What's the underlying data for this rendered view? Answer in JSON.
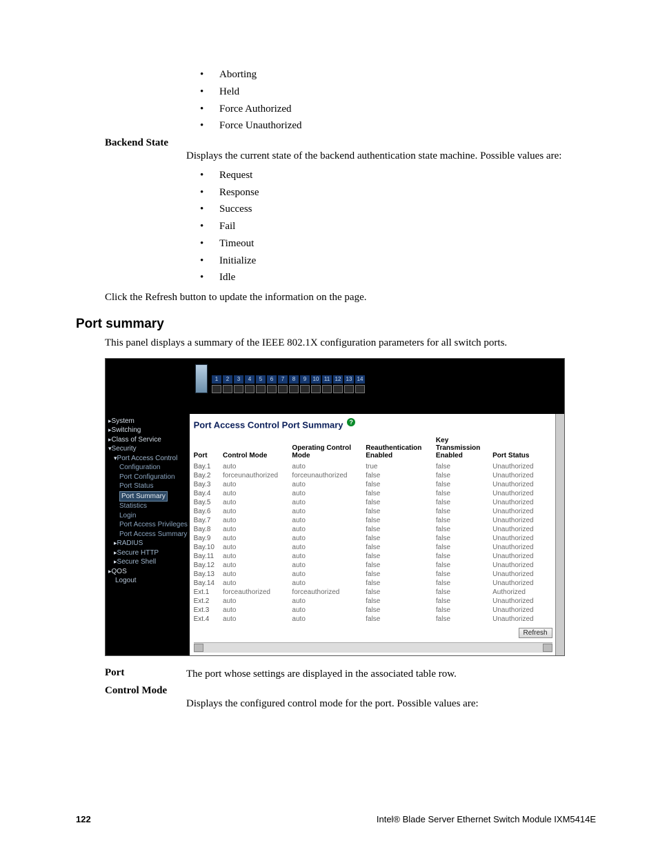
{
  "top_bullets": [
    "Aborting",
    "Held",
    "Force Authorized",
    "Force Unauthorized"
  ],
  "backend_state": {
    "term": "Backend State",
    "body": "Displays the current state of the backend authentication state machine. Possible values are:",
    "items": [
      "Request",
      "Response",
      "Success",
      "Fail",
      "Timeout",
      "Initialize",
      "Idle"
    ]
  },
  "refresh_para": "Click the Refresh button to update the information on the page.",
  "section_heading": "Port summary",
  "section_intro": "This panel displays a summary of the IEEE 802.1X configuration parameters for all switch ports.",
  "screenshot": {
    "port_numbers": [
      "1",
      "2",
      "3",
      "4",
      "5",
      "6",
      "7",
      "8",
      "9",
      "10",
      "11",
      "12",
      "13",
      "14"
    ],
    "nav": {
      "system": "System",
      "switching": "Switching",
      "class_of_service": "Class of Service",
      "security": "Security",
      "port_access_control": "Port Access Control",
      "configuration": "Configuration",
      "port_configuration": "Port Configuration",
      "port_status": "Port Status",
      "port_summary": "Port Summary",
      "statistics": "Statistics",
      "login": "Login",
      "port_access_privileges": "Port Access Privileges",
      "port_access_summary": "Port Access Summary",
      "radius": "RADIUS",
      "secure_http": "Secure HTTP",
      "secure_shell": "Secure Shell",
      "qos": "QOS",
      "logout": "Logout"
    },
    "panel_title": "Port Access Control Port Summary",
    "help_glyph": "?",
    "headers": {
      "port": "Port",
      "control_mode": "Control Mode",
      "operating_control_mode": "Operating Control\nMode",
      "reauth_enabled": "Reauthentication\nEnabled",
      "key_trans_enabled": "Key\nTransmission\nEnabled",
      "port_status": "Port Status"
    },
    "rows": [
      {
        "port": "Bay.1",
        "cm": "auto",
        "ocm": "auto",
        "re": "true",
        "kt": "false",
        "ps": "Unauthorized"
      },
      {
        "port": "Bay.2",
        "cm": "forceunauthorized",
        "ocm": "forceunauthorized",
        "re": "false",
        "kt": "false",
        "ps": "Unauthorized"
      },
      {
        "port": "Bay.3",
        "cm": "auto",
        "ocm": "auto",
        "re": "false",
        "kt": "false",
        "ps": "Unauthorized"
      },
      {
        "port": "Bay.4",
        "cm": "auto",
        "ocm": "auto",
        "re": "false",
        "kt": "false",
        "ps": "Unauthorized"
      },
      {
        "port": "Bay.5",
        "cm": "auto",
        "ocm": "auto",
        "re": "false",
        "kt": "false",
        "ps": "Unauthorized"
      },
      {
        "port": "Bay.6",
        "cm": "auto",
        "ocm": "auto",
        "re": "false",
        "kt": "false",
        "ps": "Unauthorized"
      },
      {
        "port": "Bay.7",
        "cm": "auto",
        "ocm": "auto",
        "re": "false",
        "kt": "false",
        "ps": "Unauthorized"
      },
      {
        "port": "Bay.8",
        "cm": "auto",
        "ocm": "auto",
        "re": "false",
        "kt": "false",
        "ps": "Unauthorized"
      },
      {
        "port": "Bay.9",
        "cm": "auto",
        "ocm": "auto",
        "re": "false",
        "kt": "false",
        "ps": "Unauthorized"
      },
      {
        "port": "Bay.10",
        "cm": "auto",
        "ocm": "auto",
        "re": "false",
        "kt": "false",
        "ps": "Unauthorized"
      },
      {
        "port": "Bay.11",
        "cm": "auto",
        "ocm": "auto",
        "re": "false",
        "kt": "false",
        "ps": "Unauthorized"
      },
      {
        "port": "Bay.12",
        "cm": "auto",
        "ocm": "auto",
        "re": "false",
        "kt": "false",
        "ps": "Unauthorized"
      },
      {
        "port": "Bay.13",
        "cm": "auto",
        "ocm": "auto",
        "re": "false",
        "kt": "false",
        "ps": "Unauthorized"
      },
      {
        "port": "Bay.14",
        "cm": "auto",
        "ocm": "auto",
        "re": "false",
        "kt": "false",
        "ps": "Unauthorized"
      },
      {
        "port": "Ext.1",
        "cm": "forceauthorized",
        "ocm": "forceauthorized",
        "re": "false",
        "kt": "false",
        "ps": "Authorized"
      },
      {
        "port": "Ext.2",
        "cm": "auto",
        "ocm": "auto",
        "re": "false",
        "kt": "false",
        "ps": "Unauthorized"
      },
      {
        "port": "Ext.3",
        "cm": "auto",
        "ocm": "auto",
        "re": "false",
        "kt": "false",
        "ps": "Unauthorized"
      },
      {
        "port": "Ext.4",
        "cm": "auto",
        "ocm": "auto",
        "re": "false",
        "kt": "false",
        "ps": "Unauthorized"
      }
    ],
    "refresh_label": "Refresh"
  },
  "defs_after": {
    "port_term": "Port",
    "port_body": "The port whose settings are displayed in the associated table row.",
    "cm_term": "Control Mode",
    "cm_body": "Displays the configured control mode for the port. Possible values are:"
  },
  "footer": {
    "page_number": "122",
    "doc_title": "Intel® Blade Server Ethernet Switch Module IXM5414E"
  }
}
